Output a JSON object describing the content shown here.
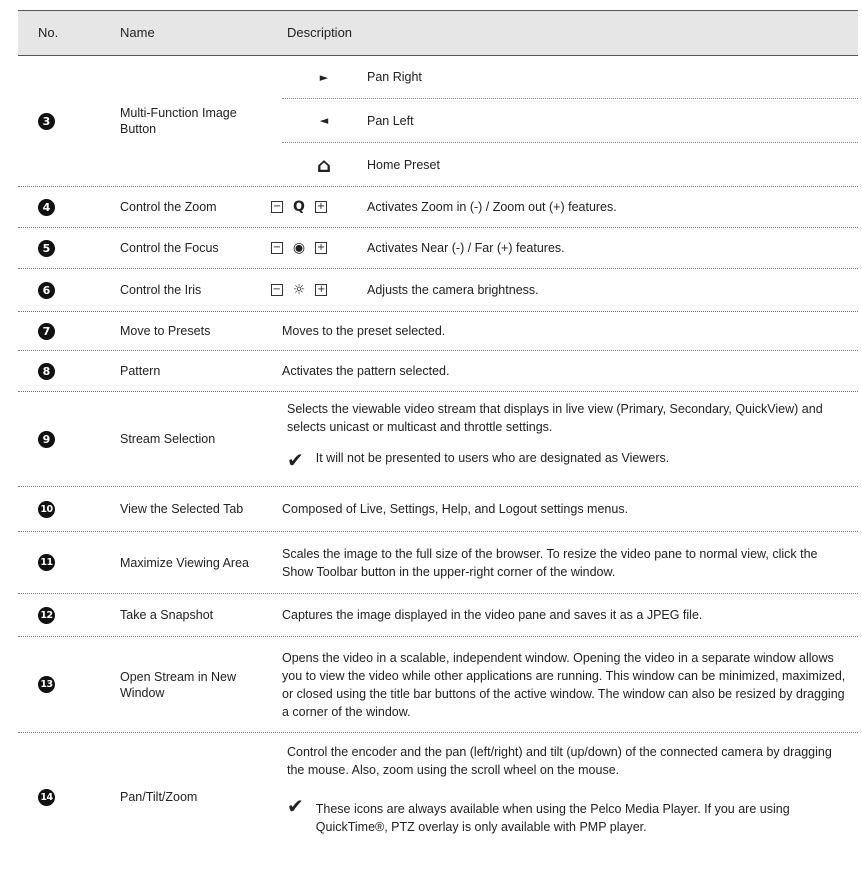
{
  "header": {
    "no": "No.",
    "name": "Name",
    "description": "Description"
  },
  "rows": [
    {
      "num": "3",
      "name": "Multi-Function Image Button",
      "sub": [
        {
          "icon": "pan-right-icon",
          "glyph": "►",
          "text": "Pan Right"
        },
        {
          "icon": "pan-left-icon",
          "glyph": "◄",
          "text": "Pan Left"
        },
        {
          "icon": "home-preset-icon",
          "glyph": "⌂",
          "text": "Home Preset"
        }
      ]
    },
    {
      "num": "4",
      "name": "Control the Zoom",
      "minus": "−",
      "plus": "+",
      "glyph": "Q",
      "text": "Activates Zoom in (-) / Zoom out (+) features."
    },
    {
      "num": "5",
      "name": "Control the Focus",
      "minus": "−",
      "plus": "+",
      "glyph": "◉",
      "text": "Activates Near (-) / Far (+) features."
    },
    {
      "num": "6",
      "name": "Control the Iris",
      "minus": "−",
      "plus": "+",
      "glyph": "☼",
      "text": "Adjusts the camera brightness."
    },
    {
      "num": "7",
      "name": "Move to Presets",
      "text": "Moves to the preset selected."
    },
    {
      "num": "8",
      "name": "Pattern",
      "text": "Activates the pattern selected."
    },
    {
      "num": "9",
      "name": "Stream Selection",
      "text": "Selects the viewable video stream that displays in live view (Primary, Secondary, QuickView)  and selects unicast or multicast and throttle settings.",
      "note": "It will not be presented to users who are designated as Viewers."
    },
    {
      "num": "10",
      "name": "View the Selected Tab",
      "text": "Composed of Live, Settings, Help, and Logout settings menus."
    },
    {
      "num": "11",
      "name": "Maximize Viewing Area",
      "text": "Scales the image to the full size of the browser. To resize the video pane to normal view, click the Show Toolbar button in the upper-right corner of the window."
    },
    {
      "num": "12",
      "name": "Take a Snapshot",
      "text": "Captures the image displayed in the video pane and saves it as a JPEG file."
    },
    {
      "num": "13",
      "name": "Open Stream in New Window",
      "text": "Opens the video in a scalable, independent window. Opening the video in a separate window allows you to view the video while other applications are running. This window can be minimized, maximized, or closed using the title bar buttons of the active window. The window can also be resized by dragging a corner of the window."
    },
    {
      "num": "14",
      "name": "Pan/Tilt/Zoom",
      "text": "Control the encoder and the pan (left/right)  and tilt (up/down) of the connected camera by dragging the mouse. Also, zoom using the scroll wheel on the mouse.",
      "note": "These icons are always available when using the Pelco Media Player. If you are using QuickTime®, PTZ overlay is only available with PMP player."
    }
  ],
  "check": "✔"
}
